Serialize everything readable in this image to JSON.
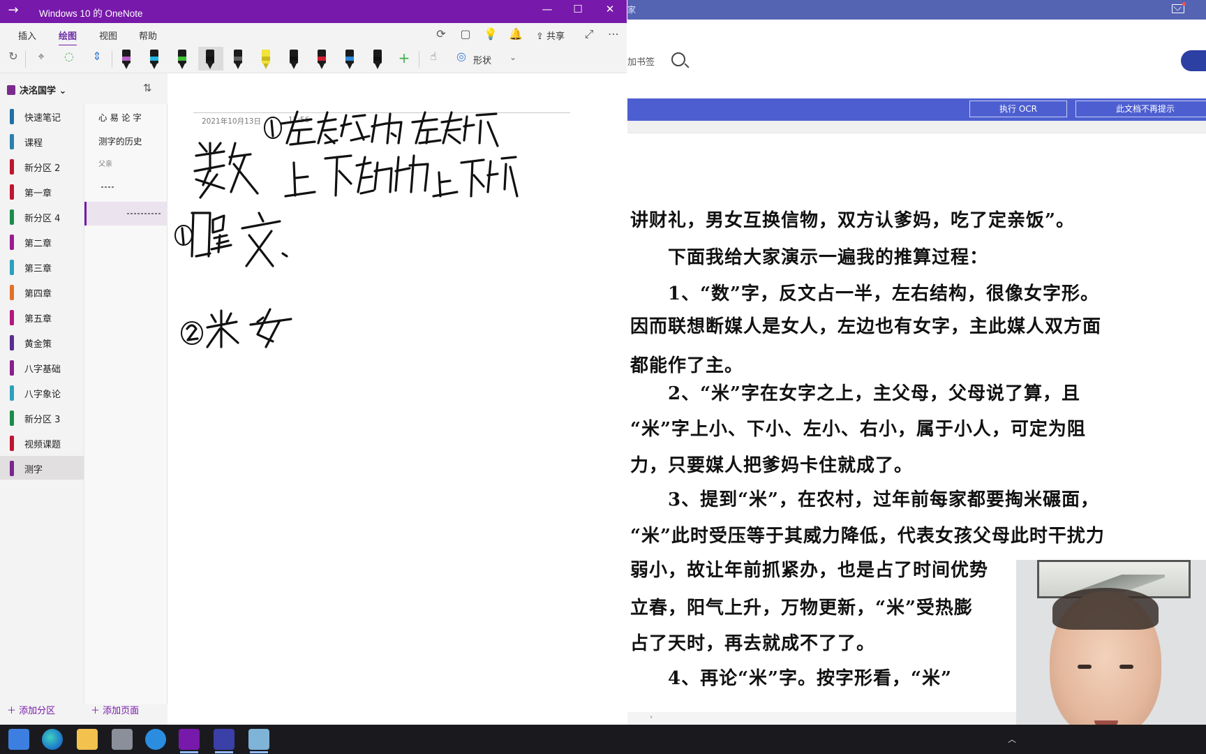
{
  "onenote": {
    "title": "Windows 10 的 OneNote",
    "tabs": [
      "插入",
      "绘图",
      "视图",
      "帮助"
    ],
    "active_tab": "绘图",
    "share_label": "共享",
    "shape_label": "形状",
    "pen_colors": [
      "#b660c6",
      "#25b5e0",
      "#3fbd34",
      "#111111",
      "#606060",
      "#f2e23a",
      "#111111",
      "#d01e2f",
      "#2a86d6",
      "#111111"
    ],
    "notebook_name": "决洺国学",
    "sections": [
      {
        "label": "快速笔记",
        "color": "#1f6fa8"
      },
      {
        "label": "课程",
        "color": "#2a7fb0"
      },
      {
        "label": "新分区 2",
        "color": "#c0152f"
      },
      {
        "label": "第一章",
        "color": "#c0152f"
      },
      {
        "label": "新分区 4",
        "color": "#1b8c4b"
      },
      {
        "label": "第二章",
        "color": "#9a1c8f"
      },
      {
        "label": "第三章",
        "color": "#2aa1bd"
      },
      {
        "label": "第四章",
        "color": "#e2702a"
      },
      {
        "label": "第五章",
        "color": "#b5167f"
      },
      {
        "label": "黄金策",
        "color": "#5a2d8f"
      },
      {
        "label": "八字基础",
        "color": "#8a1f8e"
      },
      {
        "label": "八字象论",
        "color": "#2aa1bd"
      },
      {
        "label": "新分区 3",
        "color": "#1b8c4b"
      },
      {
        "label": "视频课题",
        "color": "#c0152f"
      },
      {
        "label": "测字",
        "color": "#7a2690"
      }
    ],
    "selected_section": "测字",
    "pages": [
      "心 易 论 字",
      "测字的历史",
      "父亲",
      "",
      ""
    ],
    "add_section_label": "添加分区",
    "add_page_label": "添加页面",
    "page_date": "2021年10月13日",
    "page_time": "17:56"
  },
  "pdf": {
    "top_label": "家",
    "bookmark_label": "加书签",
    "ocr_button": "执行 OCR",
    "dismiss_button": "此文档不再提示",
    "lines": [
      "讲财礼，男女互换信物，双方认爹妈，吃了定亲饭”。",
      "　　下面我给大家演示一遍我的推算过程：",
      "　　1、“数”字，反文占一半，左右结构，很像女字形。",
      "因而联想断媒人是女人，左边也有女字，主此媒人双方面",
      "都能作了主。",
      "　　2、“米”字在女字之上，主父母，父母说了算，且",
      "“米”字上小、下小、左小、右小，属于小人，可定为阻",
      "力，只要媒人把爹妈卡住就成了。",
      "　　3、提到“米”，在农村，过年前每家都要掏米碾面，",
      "“米”此时受压等于其威力降低，代表女孩父母此时干扰力",
      "弱小，故让年前抓紧办，也是占了时间优势",
      "立春，阳气上升，万物更新，“米”受热膨",
      "占了天时，再去就成不了了。",
      "　　4、再论“米”字。按字形看，“米”"
    ]
  }
}
